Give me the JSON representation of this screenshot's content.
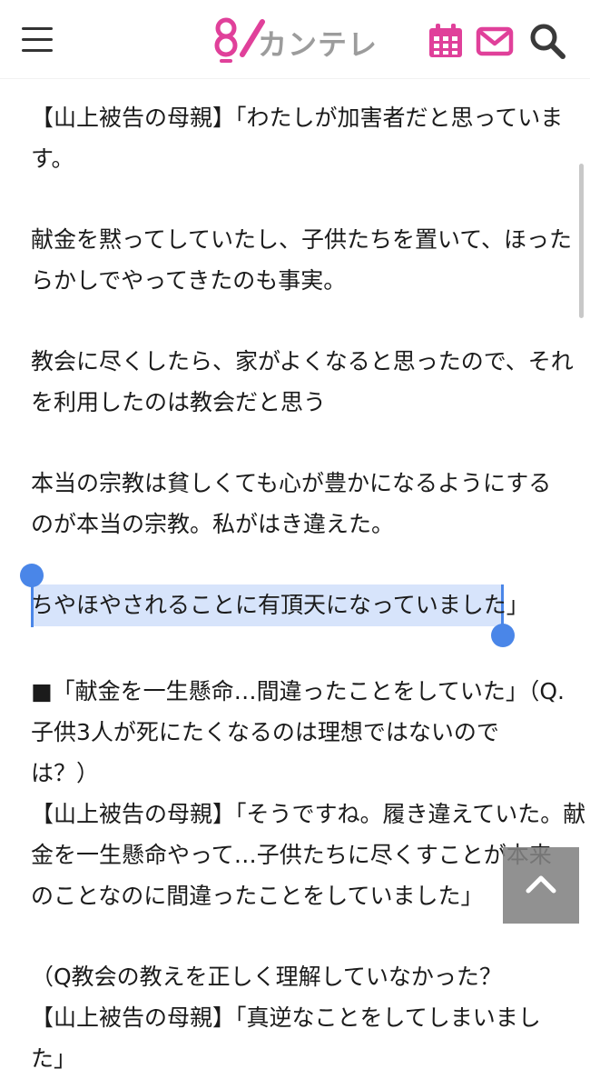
{
  "header": {
    "menu_icon": "hamburger-menu-icon",
    "logo_text": "カンテレ",
    "logo_mark": "8",
    "calendar_icon": "calendar-icon",
    "mail_icon": "mail-icon",
    "search_icon": "search-icon",
    "accent_color": "#e0409a"
  },
  "article": {
    "lines": [
      "【山上被告の母親】「わたしが加害者だと思っていま",
      "す。",
      "献金を黙ってしていたし、子供たちを置いて、ほった",
      "らかしでやってきたのも事実。",
      "教会に尽くしたら、家がよくなると思ったので、それ",
      "を利用したのは教会だと思う",
      "本当の宗教は貧しくても心が豊かになるようにする",
      "のが本当の宗教。私がはき違えた。",
      "ちやほやされることに有頂天になっていました」",
      "■「献金を一生懸命…間違ったことをしていた」（Q.",
      "子供3人が死にたくなるのは理想ではないので",
      "は？）",
      "【山上被告の母親】「そうですね。履き違えていた。献",
      "金を一生懸命やって…子供たちに尽くすことが本来",
      "のことなのに間違ったことをしていました」",
      "（Q教会の教えを正しく理解していなかった？",
      "【山上被告の母親】「真逆なことをしてしまいまし",
      "た」"
    ],
    "selected_line_index": 8
  },
  "scroll_to_top_icon": "chevron-up-icon",
  "selection_color": "#d7e4fb",
  "selection_handle_color": "#4a86e8"
}
